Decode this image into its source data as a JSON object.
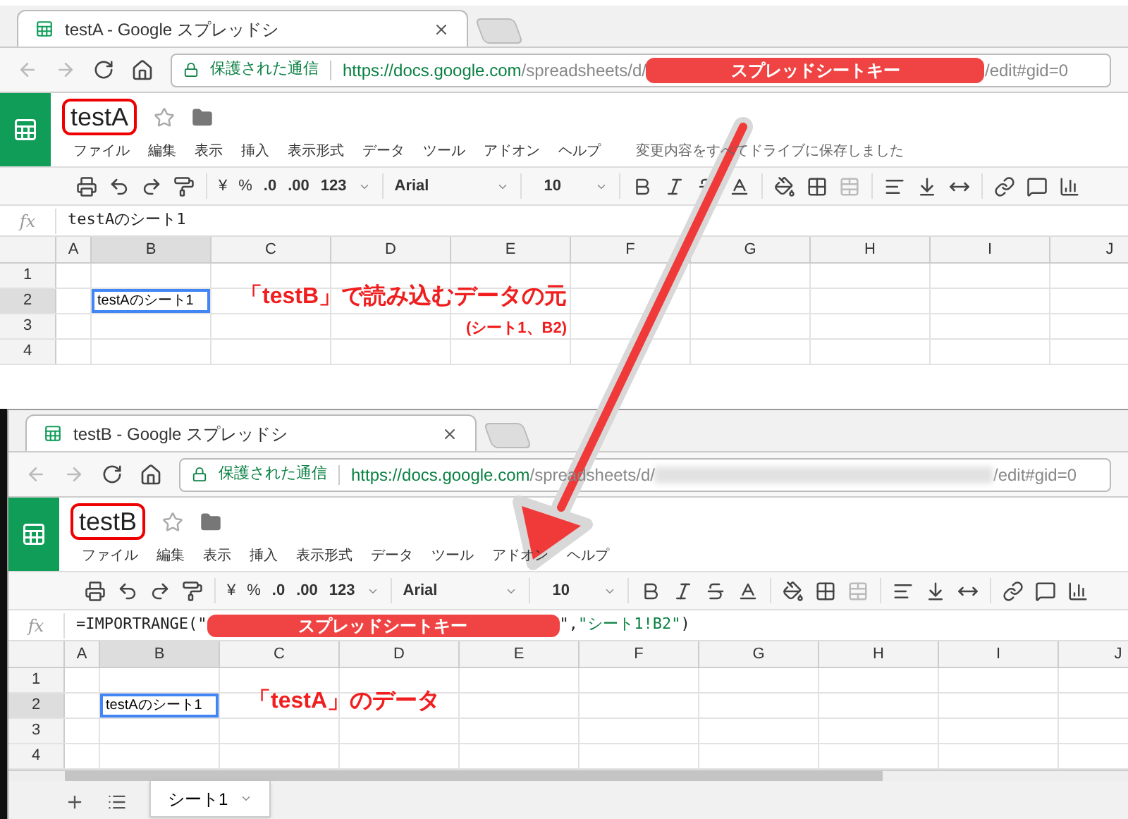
{
  "windows": [
    {
      "tab_title": "testA - Google スプレッドシ",
      "address": {
        "secure_label": "保護された通信",
        "host": "https://docs.google.com",
        "path": "/spreadsheets/d/",
        "key_label": "スプレッドシートキー",
        "suffix": "/edit#gid=0",
        "key_blurred": false
      },
      "doc_title": "testA",
      "menus": [
        "ファイル",
        "編集",
        "表示",
        "挿入",
        "表示形式",
        "データ",
        "ツール",
        "アドオン",
        "ヘルプ"
      ],
      "save_status": "変更内容をすべてドライブに保存しました",
      "toolbar": {
        "currency": "¥",
        "percent": "%",
        "decimal_less": ".0",
        "decimal_more": ".00",
        "number_format": "123",
        "font": "Arial",
        "font_size": "10"
      },
      "formula": {
        "fx": "fx",
        "parts": [
          {
            "kind": "plain",
            "text": "testAのシート1"
          }
        ]
      },
      "columns": [
        "A",
        "B",
        "C",
        "D",
        "E",
        "F",
        "G",
        "H",
        "I",
        "J"
      ],
      "rows": [
        "1",
        "2",
        "3",
        "4"
      ],
      "cell_b2": "testAのシート1",
      "annotations": [
        {
          "kind": "main",
          "text": "「testB」で読み込むデータの元"
        },
        {
          "kind": "sub",
          "text": "(シート1、B2)"
        }
      ]
    },
    {
      "tab_title": "testB - Google スプレッドシ",
      "address": {
        "secure_label": "保護された通信",
        "host": "https://docs.google.com",
        "path": "/spreadsheets/d/",
        "suffix": "/edit#gid=0",
        "key_blurred": true
      },
      "doc_title": "testB",
      "menus": [
        "ファイル",
        "編集",
        "表示",
        "挿入",
        "表示形式",
        "データ",
        "ツール",
        "アドオン",
        "ヘルプ"
      ],
      "toolbar": {
        "currency": "¥",
        "percent": "%",
        "decimal_less": ".0",
        "decimal_more": ".00",
        "number_format": "123",
        "font": "Arial",
        "font_size": "10"
      },
      "formula": {
        "fx": "fx",
        "parts": [
          {
            "kind": "plain",
            "text": "=IMPORTRANGE(\""
          },
          {
            "kind": "key",
            "text": "スプレッドシートキー"
          },
          {
            "kind": "plain",
            "text": "\","
          },
          {
            "kind": "string",
            "text": "\"シート1!B2\""
          },
          {
            "kind": "plain",
            "text": ")"
          }
        ]
      },
      "columns": [
        "A",
        "B",
        "C",
        "D",
        "E",
        "F",
        "G",
        "H",
        "I",
        "J"
      ],
      "rows": [
        "1",
        "2",
        "3",
        "4"
      ],
      "cell_b2": "testAのシート1",
      "annotations": [
        {
          "kind": "main",
          "text": "「testA」のデータ"
        }
      ],
      "sheet_tab": "シート1"
    }
  ]
}
